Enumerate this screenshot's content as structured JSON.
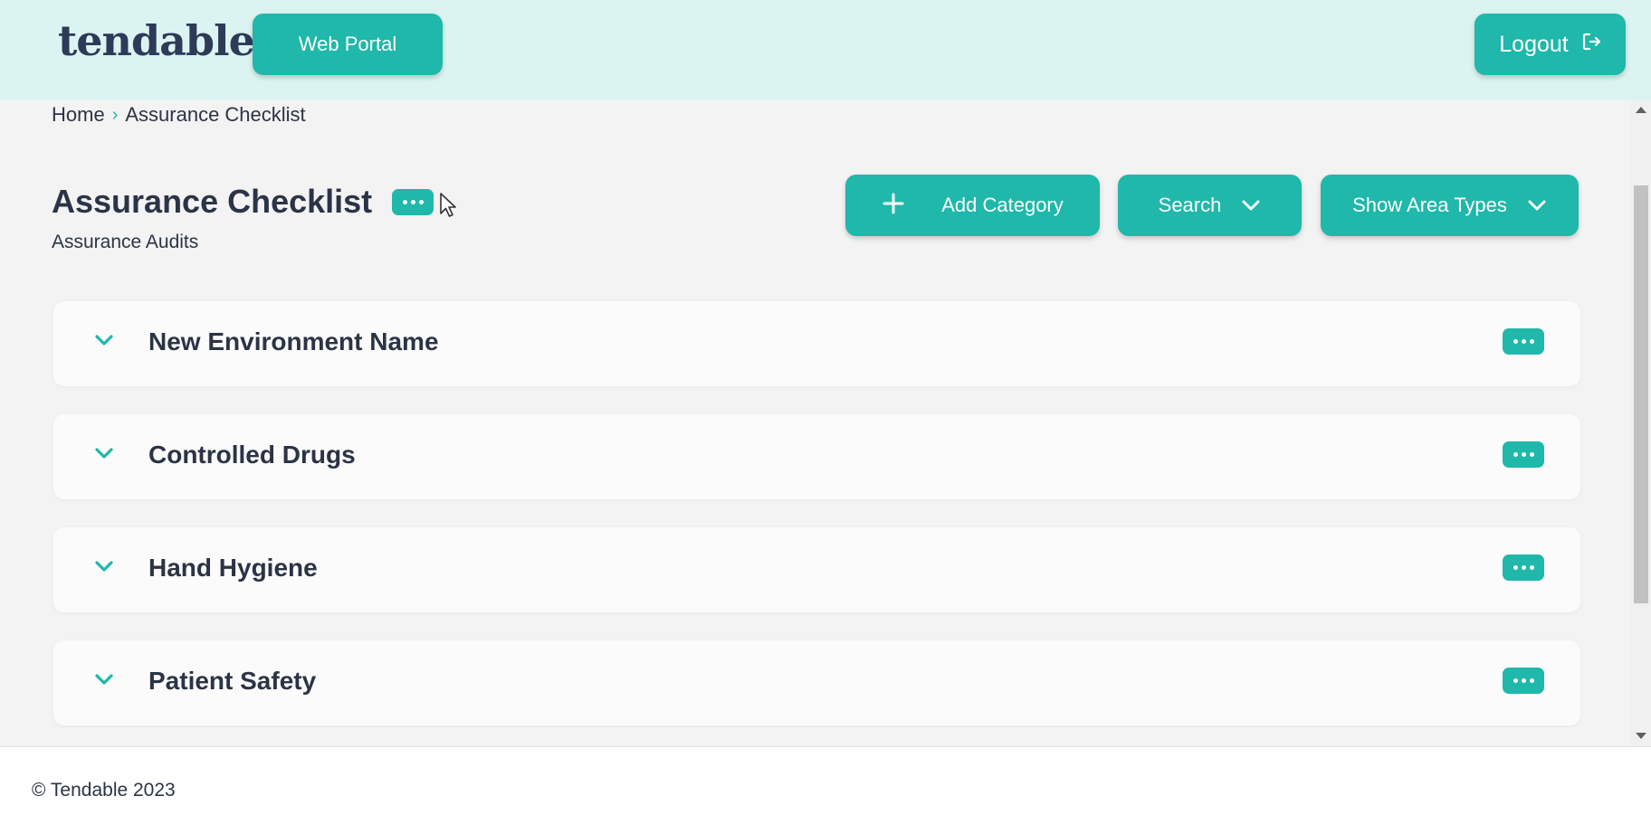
{
  "header": {
    "logo_text": "tendable",
    "web_portal_label": "Web Portal",
    "logout_label": "Logout"
  },
  "breadcrumb": {
    "items": [
      "Home",
      "Assurance Checklist"
    ],
    "separator": "›"
  },
  "page": {
    "title": "Assurance Checklist",
    "subtitle": "Assurance Audits"
  },
  "toolbar": {
    "add_category_label": "Add Category",
    "search_label": "Search",
    "show_area_types_label": "Show Area Types"
  },
  "categories": [
    {
      "name": "New Environment Name"
    },
    {
      "name": "Controlled Drugs"
    },
    {
      "name": "Hand Hygiene"
    },
    {
      "name": "Patient Safety"
    }
  ],
  "footer": {
    "copyright": "© Tendable 2023"
  },
  "colors": {
    "accent": "#1fb8aa",
    "header_bg": "#dbf4f1",
    "text": "#2b3446"
  },
  "icons": {
    "logout": "logout-icon",
    "add": "plus-icon",
    "dropdown": "chevron-down-icon",
    "more": "more-dots-icon"
  }
}
